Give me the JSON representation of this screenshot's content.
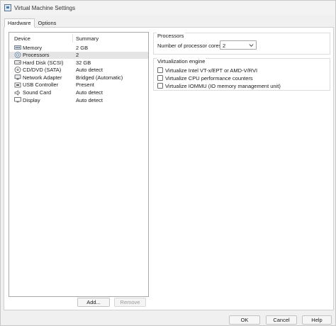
{
  "window": {
    "title": "Virtual Machine Settings"
  },
  "tabs": [
    {
      "label": "Hardware",
      "active": true
    },
    {
      "label": "Options",
      "active": false
    }
  ],
  "device_list": {
    "columns": {
      "device": "Device",
      "summary": "Summary"
    },
    "rows": [
      {
        "icon": "memory-icon",
        "device": "Memory",
        "summary": "2 GB",
        "selected": false
      },
      {
        "icon": "processor-icon",
        "device": "Processors",
        "summary": "2",
        "selected": true
      },
      {
        "icon": "hard-disk-icon",
        "device": "Hard Disk (SCSI)",
        "summary": "32 GB",
        "selected": false
      },
      {
        "icon": "cd-dvd-icon",
        "device": "CD/DVD (SATA)",
        "summary": "Auto detect",
        "selected": false
      },
      {
        "icon": "network-adapter-icon",
        "device": "Network Adapter",
        "summary": "Bridged (Automatic)",
        "selected": false
      },
      {
        "icon": "usb-icon",
        "device": "USB Controller",
        "summary": "Present",
        "selected": false
      },
      {
        "icon": "sound-card-icon",
        "device": "Sound Card",
        "summary": "Auto detect",
        "selected": false
      },
      {
        "icon": "display-icon",
        "device": "Display",
        "summary": "Auto detect",
        "selected": false
      }
    ],
    "add_label": "Add...",
    "remove_label": "Remove"
  },
  "processors": {
    "group_label": "Processors",
    "cores_label": "Number of processor cores:",
    "cores_value": "2"
  },
  "virtualization": {
    "group_label": "Virtualization engine",
    "options": [
      {
        "label": "Virtualize Intel VT-x/EPT or AMD-V/RVI",
        "checked": false
      },
      {
        "label": "Virtualize CPU performance counters",
        "checked": false
      },
      {
        "label": "Virtualize IOMMU (IO memory management unit)",
        "checked": false
      }
    ]
  },
  "footer": {
    "ok_label": "OK",
    "cancel_label": "Cancel",
    "help_label": "Help"
  }
}
